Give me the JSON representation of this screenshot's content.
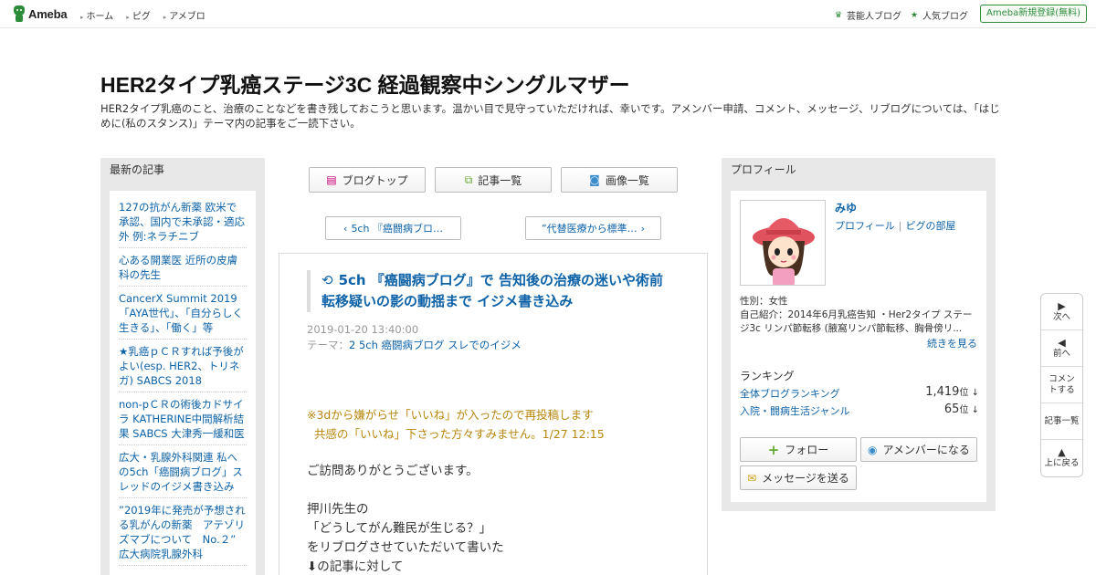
{
  "topbar": {
    "logo_text": "Ameba",
    "nav": [
      "ホーム",
      "ピグ",
      "アメブロ"
    ],
    "right_links": [
      "芸能人ブログ",
      "人気ブログ"
    ],
    "register": "Ameba新規登録(無料)"
  },
  "header": {
    "title": "HER2タイプ乳癌ステージ3C 経過観察中シングルマザー",
    "description": "HER2タイプ乳癌のこと、治療のことなどを書き残しておこうと思います。温かい目で見守っていただければ、幸いです。アメンバー申請、コメント、メッセージ、リブログについては、「はじめに(私のスタンス)」テーマ内の記事をご一読下さい。"
  },
  "left": {
    "heading": "最新の記事",
    "items": [
      "127の抗がん新薬 欧米で承認、国内で未承認・適応外 例:ネラチニブ",
      "心ある開業医 近所の皮膚科の先生",
      "CancerX Summit 2019 「AYA世代」、「自分らしく生きる」、「働く」等",
      "★乳癌ｐＣＲすれば予後がよい(esp. HER2、トリネガ) SABCS 2018",
      "non-pＣＲの術後カドサイラ KATHERINE中間解析結果 SABCS 大津秀一緩和医",
      "広大・乳腺外科関連 私への5ch「癌闘病ブログ」スレッドのイジメ書き込み",
      "”2019年に発売が予想される乳がんの新薬　アテゾリズマブについて　No.２” 広大病院乳腺外科"
    ]
  },
  "center": {
    "tabs": [
      "ブログトップ",
      "記事一覧",
      "画像一覧"
    ],
    "prev": "5ch 『癌闘病ブロ…",
    "next": "”代替医療から標準…",
    "article": {
      "title": "5ch 『癌闘病ブログ』で 告知後の治療の迷いや術前転移疑いの影の動揺まで イジメ書き込み",
      "date": "2019-01-20 13:40:00",
      "theme_label": "テーマ：",
      "theme": "2 5ch 癌闘病ブログ スレでのイジメ",
      "note_line1": "※3dから嫌がらせ「いいね」が入ったので再投稿します",
      "note_line2": "共感の「いいね」下さった方々すみません。1/27 12:15",
      "body": [
        "ご訪問ありがとうございます。",
        "",
        "押川先生の",
        "「どうしてがん難民が生じる？」",
        "をリブログさせていただいて書いた",
        "⬇の記事に対して"
      ]
    }
  },
  "right": {
    "heading": "プロフィール",
    "name": "みゆ",
    "link_profile": "プロフィール",
    "link_room": "ピグの部屋",
    "gender": "性別：女性",
    "intro": "自己紹介：2014年6月乳癌告知 ・Her2タイプ ステージ3c リンパ節転移 (腋窩リンパ節転移、胸骨傍リ...",
    "more": "続きを見る",
    "ranking_heading": "ランキング",
    "rankings": [
      {
        "label": "全体ブログランキング",
        "value": "1,419",
        "unit": "位 ↓"
      },
      {
        "label": "入院・闘病生活ジャンル",
        "value": "65",
        "unit": "位 ↓"
      }
    ],
    "btn_follow": "フォロー",
    "btn_amember": "アメンバーになる",
    "btn_message": "メッセージを送る"
  },
  "floatnav": {
    "next": "次へ",
    "prev": "前へ",
    "comment": "コメントする",
    "list": "記事一覧",
    "top": "上に戻る"
  },
  "colors": {
    "brand_green": "#2d8c3c",
    "link_blue": "#0d62a8",
    "note_gold": "#b8860b"
  }
}
